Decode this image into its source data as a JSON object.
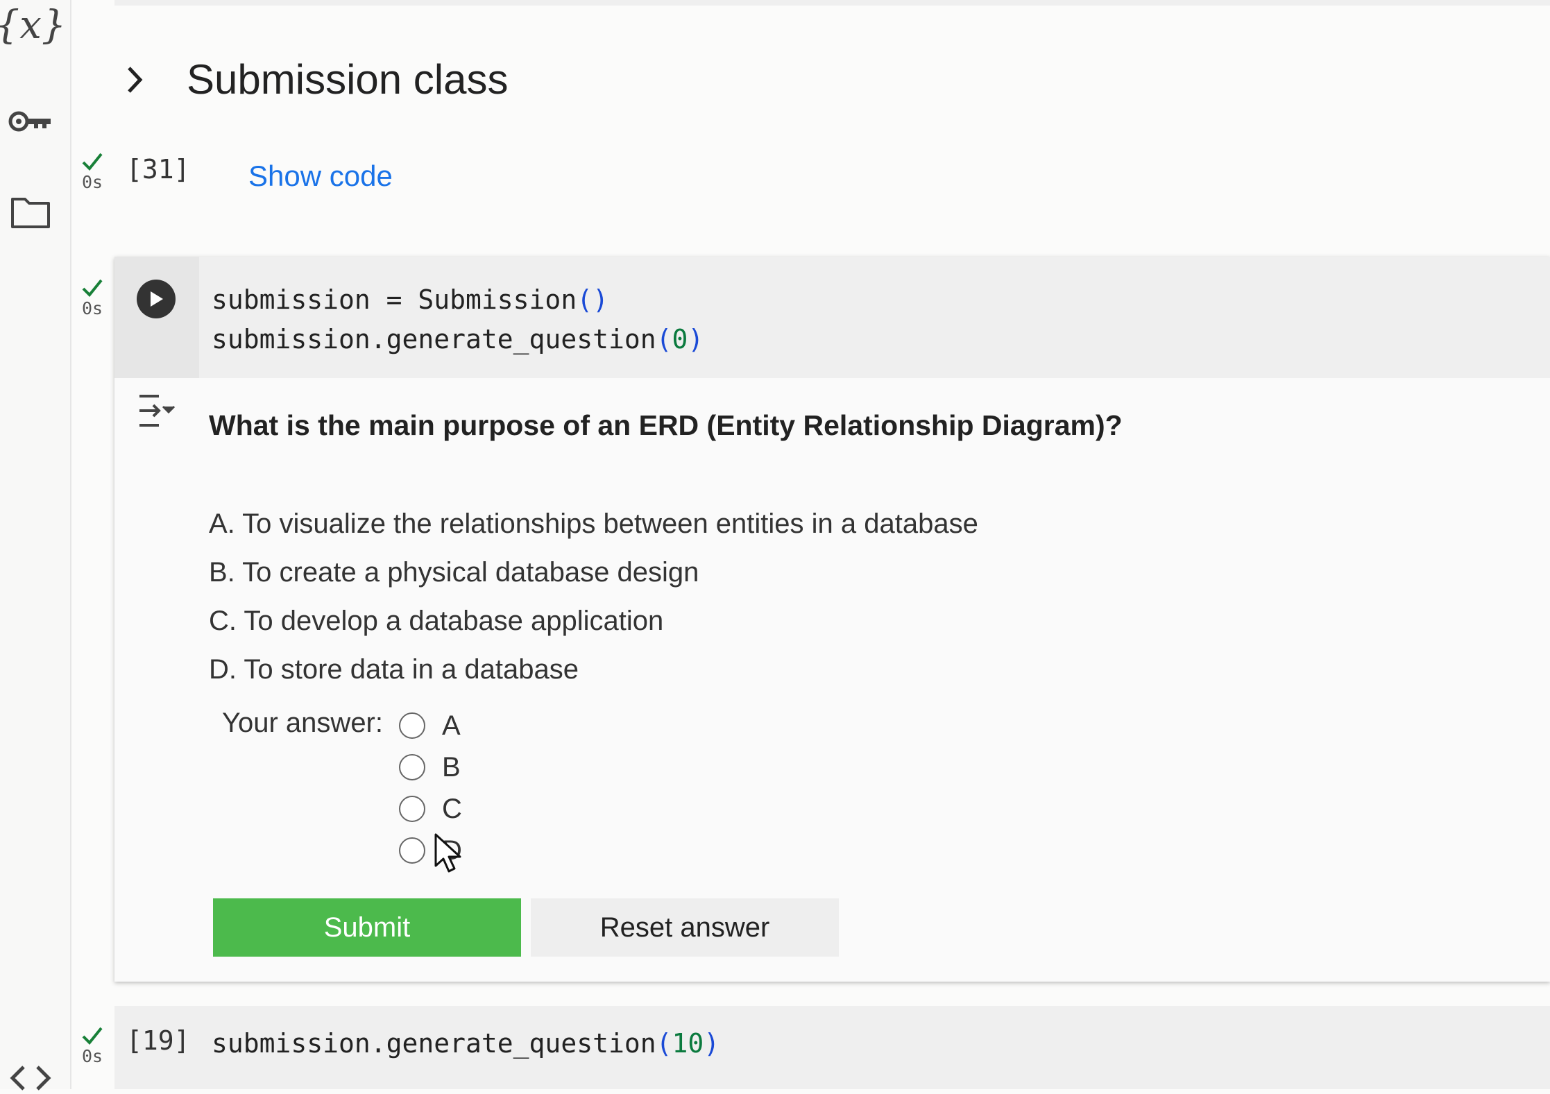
{
  "sidebar": {
    "variables_icon_text": "{x}",
    "icons": [
      "variables-icon",
      "key-icon",
      "folder-icon",
      "code-icon"
    ]
  },
  "section": {
    "title": "Submission class"
  },
  "cell1": {
    "status_time": "0s",
    "exec_count": "[31]",
    "show_code": "Show code"
  },
  "cell2": {
    "status_time": "0s",
    "code_line1_a": "submission = Submission",
    "code_line1_b": "()",
    "code_line2_a": "submission.generate_question",
    "code_line2_b": "(",
    "code_line2_num": "0",
    "code_line2_c": ")",
    "question": "What is the main purpose of an ERD (Entity Relationship Diagram)?",
    "options": [
      "A. To visualize the relationships between entities in a database",
      "B. To create a physical database design",
      "C. To develop a database application",
      "D. To store data in a database"
    ],
    "answer_label": "Your answer:",
    "radio_options": [
      "A",
      "B",
      "C",
      "D"
    ],
    "submit": "Submit",
    "reset": "Reset answer"
  },
  "cell3": {
    "status_time": "0s",
    "exec_count": "[19]",
    "code_a": "submission.generate_question",
    "code_b": "(",
    "code_num": "10",
    "code_c": ")"
  },
  "colors": {
    "check": "#188038",
    "link": "#1a73e8",
    "submit_bg": "#4cba4c",
    "paren": "#1a4ad6",
    "number": "#0b7a3e"
  }
}
